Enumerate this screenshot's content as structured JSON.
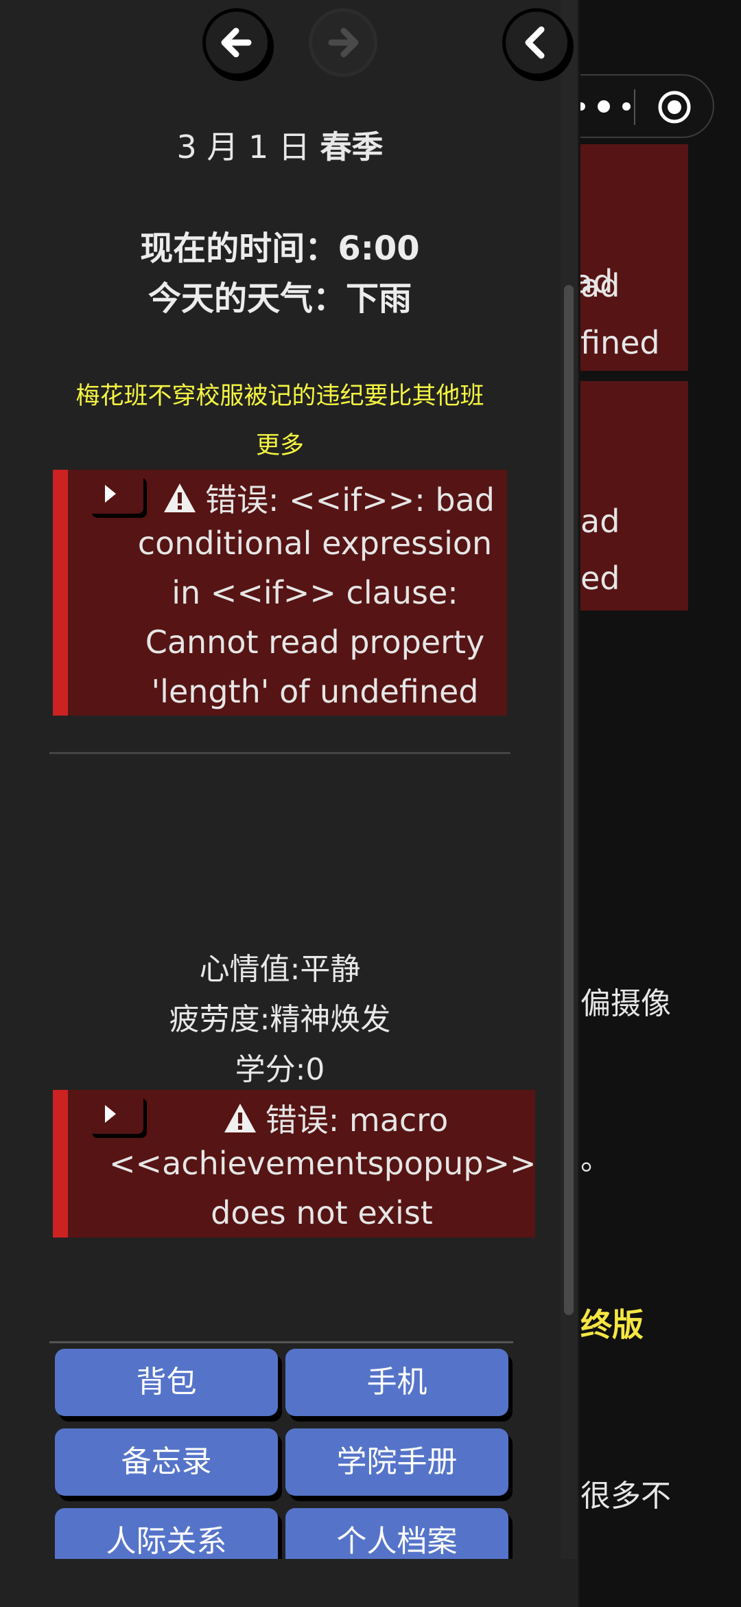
{
  "background_page": {
    "error_box_1": {
      "lines": [
        "ad",
        "fined"
      ]
    },
    "error_box_2": {
      "lines": [
        "ad",
        "ed"
      ]
    },
    "text_fragments": [
      "偏摄像",
      "。",
      "终版",
      "很多不"
    ]
  },
  "capsule": {
    "more_icon": "more-dots-icon",
    "close_icon": "target-circle-icon"
  },
  "nav": {
    "back_icon": "arrow-left-icon",
    "forward_icon": "arrow-right-icon",
    "collapse_icon": "chevron-left-icon"
  },
  "status": {
    "date": "3 月 1 日",
    "season": "春季",
    "time_label": "现在的时间：",
    "time_value": "6:00",
    "weather_label": "今天的天气：",
    "weather_value": "下雨"
  },
  "notice": {
    "line1": "梅花班不穿校服被记的违纪要比其他班",
    "line2": "更多"
  },
  "errors": [
    {
      "lines": [
        "错误: <<if>>: bad",
        "conditional expression",
        "in <<if>> clause:",
        "Cannot read property",
        "'length' of undefined"
      ]
    },
    {
      "lines": [
        "错误: macro",
        "<<achievementspopup>>",
        "does not exist"
      ]
    }
  ],
  "stats": {
    "mood": "心情值:平静",
    "fatigue": "疲劳度:精神焕发",
    "credit": "学分:0"
  },
  "menu": {
    "backpack": "背包",
    "phone": "手机",
    "memo": "备忘录",
    "handbook": "学院手册",
    "relations": "人际关系",
    "profile": "个人档案"
  },
  "colors": {
    "error_bg": "#561414",
    "error_stripe": "#cc2222",
    "notice": "#f5f542",
    "menu_button": "#5574c9"
  }
}
